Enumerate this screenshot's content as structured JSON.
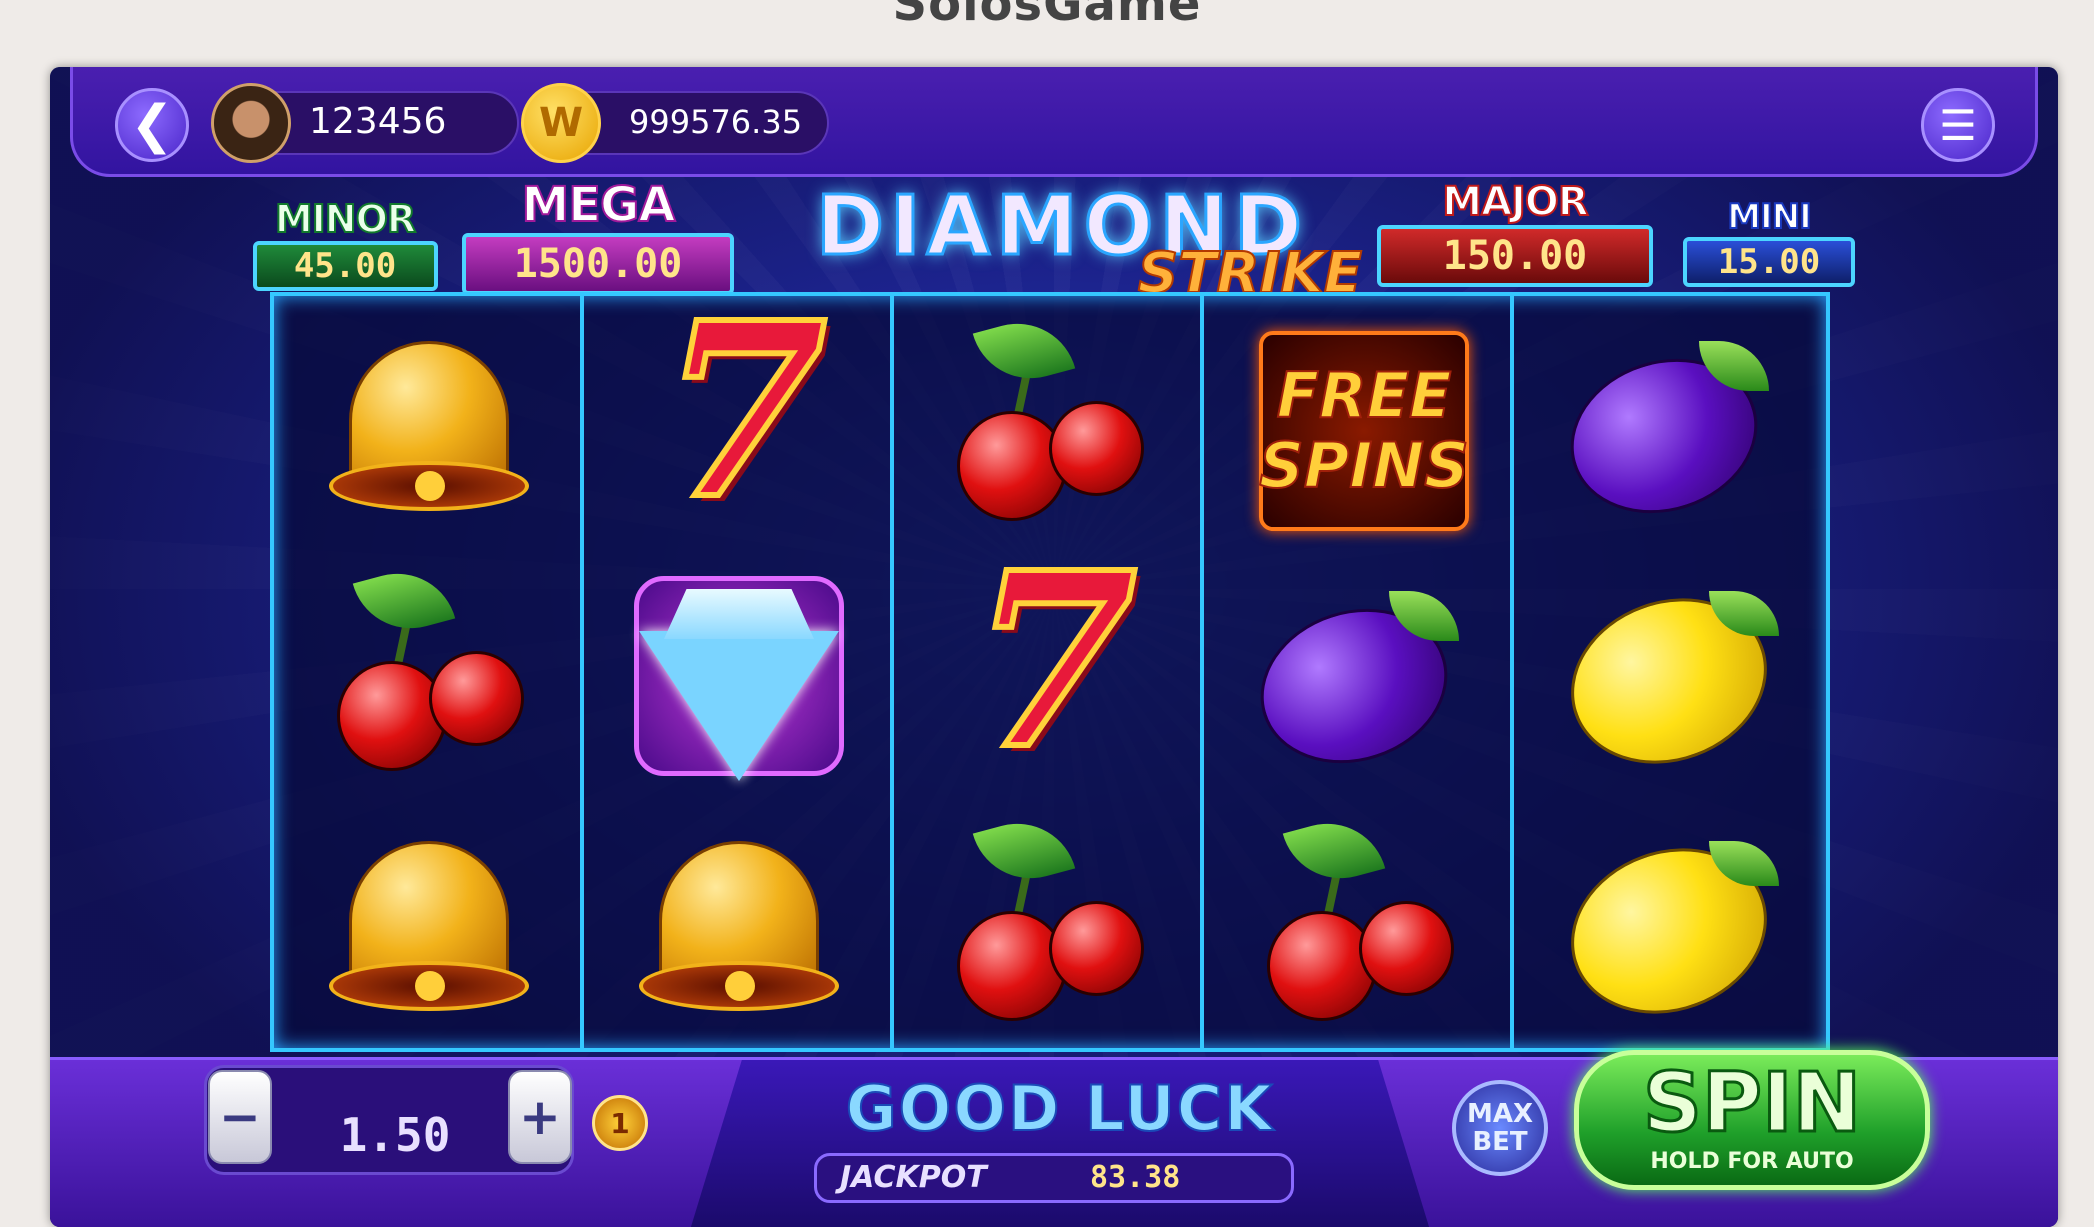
{
  "site": {
    "title": "SolosGame"
  },
  "player": {
    "id": "123456",
    "balance": "999576.35",
    "coin_symbol": "W"
  },
  "jackpots": {
    "minor": {
      "label": "MINOR",
      "value": "45.00"
    },
    "mega": {
      "label": "MEGA",
      "value": "1500.00"
    },
    "major": {
      "label": "MAJOR",
      "value": "150.00"
    },
    "mini": {
      "label": "MINI",
      "value": "15.00"
    }
  },
  "logo": {
    "main": "DIAMOND",
    "sub": "STRIKE"
  },
  "reels": [
    [
      "bell",
      "cherry",
      "bell"
    ],
    [
      "seven",
      "diamond",
      "bell"
    ],
    [
      "cherry",
      "seven",
      "cherry"
    ],
    [
      "free-spins",
      "plum",
      "cherry"
    ],
    [
      "plum",
      "lemon",
      "lemon"
    ]
  ],
  "free_spins": {
    "line1": "FREE",
    "line2": "SPINS"
  },
  "controls": {
    "minus": "−",
    "plus": "+",
    "bet": "1.50",
    "lines": "1",
    "status": "GOOD LUCK",
    "jackpot_label": "JACKPOT",
    "jackpot_value": "83.38",
    "max_bet_line1": "MAX",
    "max_bet_line2": "BET",
    "spin": "SPIN",
    "spin_sub": "HOLD FOR AUTO"
  },
  "icons": {
    "back": "back-arrow-icon",
    "menu": "hamburger-menu-icon"
  }
}
